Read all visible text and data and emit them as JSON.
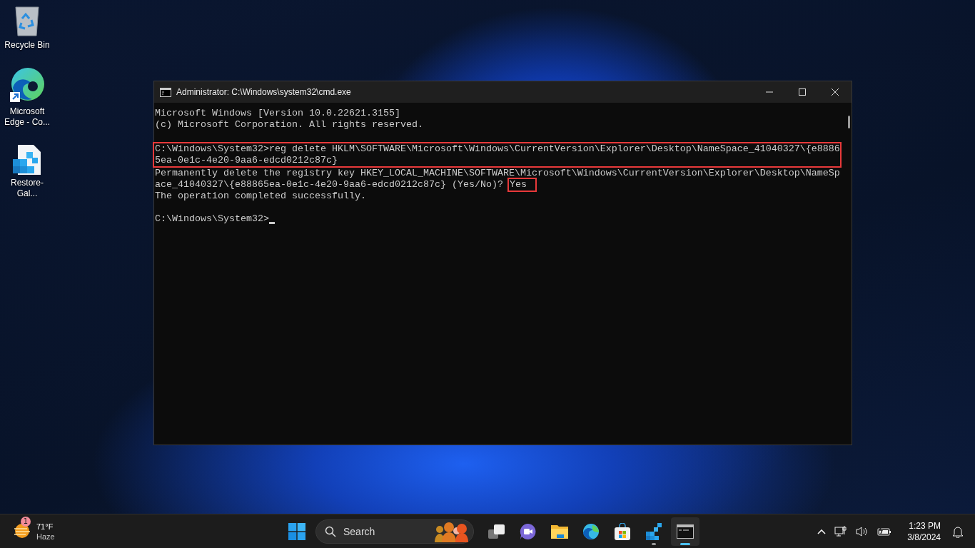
{
  "desktop": {
    "icons": [
      {
        "label": "Recycle Bin",
        "kind": "recycle-bin",
        "shortcut": false
      },
      {
        "label": "Microsoft Edge - Co...",
        "kind": "edge",
        "shortcut": true
      },
      {
        "label": "Restore-Gal...",
        "kind": "registry-file",
        "shortcut": false
      }
    ]
  },
  "window": {
    "title": "Administrator: C:\\Windows\\system32\\cmd.exe",
    "console": {
      "blocks": [
        {
          "kind": "text",
          "boxed": false,
          "lines": [
            {
              "cursor": false,
              "spans": [
                {
                  "text": "Microsoft Windows [Version 10.0.22621.3155]",
                  "boxed": false
                }
              ]
            },
            {
              "cursor": false,
              "spans": [
                {
                  "text": "(c) Microsoft Corporation. All rights reserved.",
                  "boxed": false
                }
              ]
            }
          ]
        },
        {
          "kind": "blank"
        },
        {
          "kind": "text",
          "boxed": true,
          "lines": [
            {
              "cursor": false,
              "spans": [
                {
                  "text": "C:\\Windows\\System32>reg delete HKLM\\SOFTWARE\\Microsoft\\Windows\\CurrentVersion\\Explorer\\Desktop\\NameSpace_41040327\\{e8886",
                  "boxed": false
                }
              ]
            },
            {
              "cursor": false,
              "spans": [
                {
                  "text": "5ea-0e1c-4e20-9aa6-edcd0212c87c}",
                  "boxed": false
                }
              ]
            }
          ]
        },
        {
          "kind": "text",
          "boxed": false,
          "lines": [
            {
              "cursor": false,
              "spans": [
                {
                  "text": "Permanently delete the registry key HKEY_LOCAL_MACHINE\\SOFTWARE\\Microsoft\\Windows\\CurrentVersion\\Explorer\\Desktop\\NameSp",
                  "boxed": false
                }
              ]
            },
            {
              "cursor": false,
              "spans": [
                {
                  "text": "ace_41040327\\{e88865ea-0e1c-4e20-9aa6-edcd0212c87c} (Yes/No)? ",
                  "boxed": false
                },
                {
                  "text": "Yes",
                  "boxed": true
                }
              ]
            },
            {
              "cursor": false,
              "spans": [
                {
                  "text": "The operation completed successfully.",
                  "boxed": false
                }
              ]
            }
          ]
        },
        {
          "kind": "blank"
        },
        {
          "kind": "text",
          "boxed": false,
          "lines": [
            {
              "cursor": true,
              "spans": [
                {
                  "text": "C:\\Windows\\System32>",
                  "boxed": false
                }
              ]
            }
          ]
        }
      ]
    }
  },
  "taskbar": {
    "weather": {
      "badge": "1",
      "temperature": "71°F",
      "condition": "Haze"
    },
    "search": {
      "label": "Search"
    },
    "apps": [
      {
        "kind": "start",
        "running": false,
        "active": false
      },
      {
        "kind": "task-view",
        "running": false,
        "active": false
      },
      {
        "kind": "video-chat",
        "running": false,
        "active": false
      },
      {
        "kind": "file-explorer",
        "running": false,
        "active": false
      },
      {
        "kind": "edge",
        "running": false,
        "active": false
      },
      {
        "kind": "store",
        "running": false,
        "active": false
      },
      {
        "kind": "registry-editor",
        "running": true,
        "active": false
      },
      {
        "kind": "command-prompt",
        "running": true,
        "active": true
      }
    ],
    "clock": {
      "time": "1:23 PM",
      "date": "3/8/2024"
    }
  }
}
